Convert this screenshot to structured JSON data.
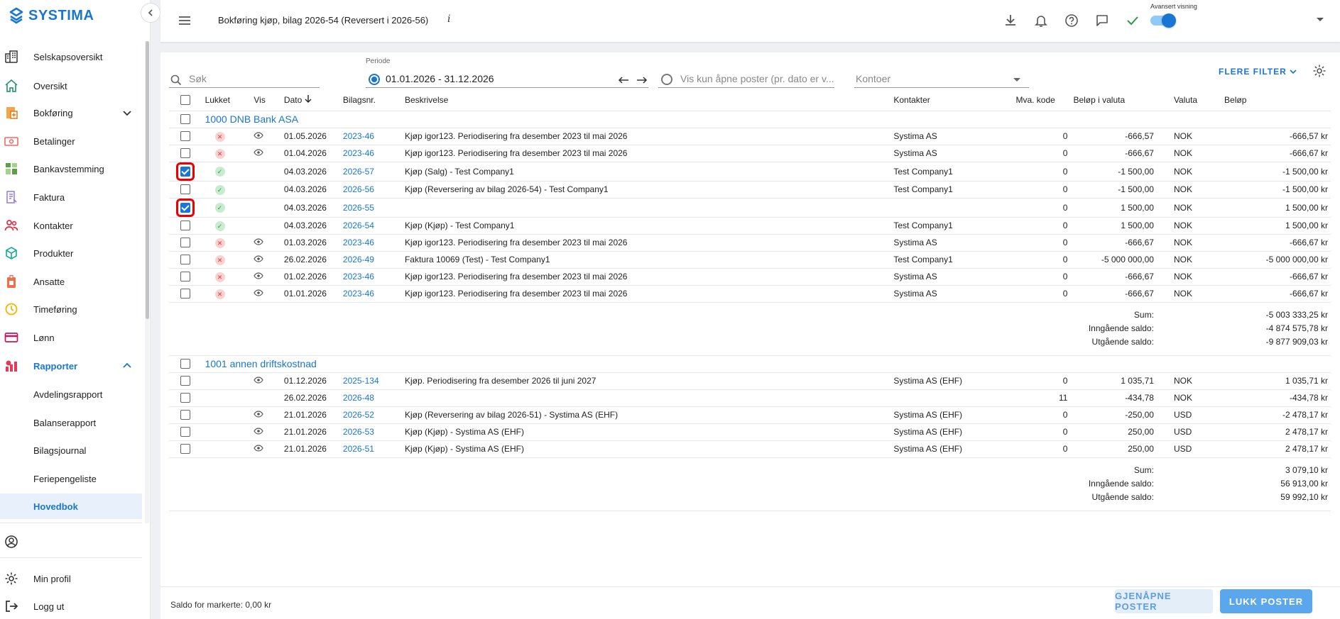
{
  "app": {
    "brand": "SYSTIMA"
  },
  "header": {
    "title": "Bokføring kjøp, bilag 2026-54 (Reversert i 2026-56)",
    "info": "i",
    "advanced_label": "Avansert visning"
  },
  "sidebar": {
    "items": [
      {
        "label": "Selskapsoversikt",
        "icon": "office-building-icon"
      },
      {
        "label": "Oversikt",
        "icon": "home-icon"
      },
      {
        "label": "Bokføring",
        "icon": "ledger-icon"
      },
      {
        "label": "Betalinger",
        "icon": "cash-icon"
      },
      {
        "label": "Bankavstemming",
        "icon": "bank-icon"
      },
      {
        "label": "Faktura",
        "icon": "invoice-icon"
      },
      {
        "label": "Kontakter",
        "icon": "people-icon"
      },
      {
        "label": "Produkter",
        "icon": "cube-icon"
      },
      {
        "label": "Ansatte",
        "icon": "badge-icon"
      },
      {
        "label": "Timeføring",
        "icon": "clock-icon"
      },
      {
        "label": "Lønn",
        "icon": "card-icon"
      },
      {
        "label": "Rapporter",
        "icon": "report-icon"
      }
    ],
    "sub_items": [
      "Avdelingsrapport",
      "Balanserapport",
      "Bilagsjournal",
      "Feriepengeliste",
      "Hovedbok"
    ],
    "bottom": [
      {
        "label": "Min profil",
        "icon": "gear-icon"
      },
      {
        "label": "Logg ut",
        "icon": "logout-icon"
      }
    ]
  },
  "filters": {
    "search_placeholder": "Søk",
    "period_label": "Periode",
    "period_value": "01.01.2026 - 31.12.2026",
    "open_posts_placeholder": "Vis kun åpne poster (pr. dato er v...",
    "accounts_placeholder": "Kontoer",
    "more_filters": "FLERE FILTER"
  },
  "table": {
    "headers": [
      "Lukket",
      "Vis",
      "Dato",
      "Bilagsnr.",
      "Beskrivelse",
      "Kontakter",
      "Mva. kode",
      "Beløp i valuta",
      "Valuta",
      "Beløp"
    ],
    "groups": [
      {
        "title": "1000 DNB Bank ASA",
        "rows": [
          {
            "checked": false,
            "hl": false,
            "status": "closed",
            "eye": true,
            "date": "01.05.2026",
            "bilag": "2023-46",
            "desc": "Kjøp igor123. Periodisering fra desember 2023 til mai 2026",
            "contact": "Systima AS",
            "mva": "0",
            "valuta_amount": "-666,57",
            "currency": "NOK",
            "amount": "-666,57 kr"
          },
          {
            "checked": false,
            "hl": false,
            "status": "closed",
            "eye": true,
            "date": "01.04.2026",
            "bilag": "2023-46",
            "desc": "Kjøp igor123. Periodisering fra desember 2023 til mai 2026",
            "contact": "Systima AS",
            "mva": "0",
            "valuta_amount": "-666,67",
            "currency": "NOK",
            "amount": "-666,67 kr"
          },
          {
            "checked": true,
            "hl": true,
            "status": "open",
            "eye": false,
            "date": "04.03.2026",
            "bilag": "2026-57",
            "desc": "Kjøp (Salg) - Test Company1",
            "contact": "Test Company1",
            "mva": "0",
            "valuta_amount": "-1 500,00",
            "currency": "NOK",
            "amount": "-1 500,00 kr"
          },
          {
            "checked": false,
            "hl": false,
            "status": "open",
            "eye": false,
            "date": "04.03.2026",
            "bilag": "2026-56",
            "desc": "Kjøp (Reversering av bilag 2026-54) - Test Company1",
            "contact": "Test Company1",
            "mva": "0",
            "valuta_amount": "-1 500,00",
            "currency": "NOK",
            "amount": "-1 500,00 kr"
          },
          {
            "checked": true,
            "hl": true,
            "status": "open",
            "eye": false,
            "date": "04.03.2026",
            "bilag": "2026-55",
            "desc": "",
            "contact": "",
            "mva": "0",
            "valuta_amount": "1 500,00",
            "currency": "NOK",
            "amount": "1 500,00 kr"
          },
          {
            "checked": false,
            "hl": false,
            "status": "open",
            "eye": false,
            "date": "04.03.2026",
            "bilag": "2026-54",
            "desc": "Kjøp (Kjøp) - Test Company1",
            "contact": "Test Company1",
            "mva": "0",
            "valuta_amount": "1 500,00",
            "currency": "NOK",
            "amount": "1 500,00 kr"
          },
          {
            "checked": false,
            "hl": false,
            "status": "closed",
            "eye": true,
            "date": "01.03.2026",
            "bilag": "2023-46",
            "desc": "Kjøp igor123. Periodisering fra desember 2023 til mai 2026",
            "contact": "Systima AS",
            "mva": "0",
            "valuta_amount": "-666,67",
            "currency": "NOK",
            "amount": "-666,67 kr"
          },
          {
            "checked": false,
            "hl": false,
            "status": "closed",
            "eye": true,
            "date": "26.02.2026",
            "bilag": "2026-49",
            "desc": "Faktura 10069 (Test) - Test Company1",
            "contact": "Test Company1",
            "mva": "0",
            "valuta_amount": "-5 000 000,00",
            "currency": "NOK",
            "amount": "-5 000 000,00 kr"
          },
          {
            "checked": false,
            "hl": false,
            "status": "closed",
            "eye": true,
            "date": "01.02.2026",
            "bilag": "2023-46",
            "desc": "Kjøp igor123. Periodisering fra desember 2023 til mai 2026",
            "contact": "Systima AS",
            "mva": "0",
            "valuta_amount": "-666,67",
            "currency": "NOK",
            "amount": "-666,67 kr"
          },
          {
            "checked": false,
            "hl": false,
            "status": "closed",
            "eye": true,
            "date": "01.01.2026",
            "bilag": "2023-46",
            "desc": "Kjøp igor123. Periodisering fra desember 2023 til mai 2026",
            "contact": "Systima AS",
            "mva": "0",
            "valuta_amount": "-666,67",
            "currency": "NOK",
            "amount": "-666,67 kr"
          }
        ],
        "summary": [
          {
            "label": "Sum:",
            "value": "-5 003 333,25 kr"
          },
          {
            "label": "Inngående saldo:",
            "value": "-4 874 575,78 kr"
          },
          {
            "label": "Utgående saldo:",
            "value": "-9 877 909,03 kr"
          }
        ]
      },
      {
        "title": "1001 annen driftskostnad",
        "rows": [
          {
            "checked": false,
            "hl": false,
            "status": "",
            "eye": true,
            "date": "01.12.2026",
            "bilag": "2025-134",
            "desc": "Kjøp. Periodisering fra desember 2026 til juni 2027",
            "contact": "Systima AS (EHF)",
            "mva": "0",
            "valuta_amount": "1 035,71",
            "currency": "NOK",
            "amount": "1 035,71 kr"
          },
          {
            "checked": false,
            "hl": false,
            "status": "",
            "eye": false,
            "date": "26.02.2026",
            "bilag": "2026-48",
            "desc": "",
            "contact": "",
            "mva": "11",
            "valuta_amount": "-434,78",
            "currency": "NOK",
            "amount": "-434,78 kr"
          },
          {
            "checked": false,
            "hl": false,
            "status": "",
            "eye": true,
            "date": "21.01.2026",
            "bilag": "2026-52",
            "desc": "Kjøp (Reversering av bilag 2026-51) - Systima AS (EHF)",
            "contact": "Systima AS (EHF)",
            "mva": "0",
            "valuta_amount": "-250,00",
            "currency": "USD",
            "amount": "-2 478,17 kr"
          },
          {
            "checked": false,
            "hl": false,
            "status": "",
            "eye": true,
            "date": "21.01.2026",
            "bilag": "2026-53",
            "desc": "Kjøp (Kjøp) - Systima AS (EHF)",
            "contact": "Systima AS (EHF)",
            "mva": "0",
            "valuta_amount": "250,00",
            "currency": "USD",
            "amount": "2 478,17 kr"
          },
          {
            "checked": false,
            "hl": false,
            "status": "",
            "eye": true,
            "date": "21.01.2026",
            "bilag": "2026-51",
            "desc": "Kjøp (Kjøp) - Systima AS (EHF)",
            "contact": "Systima AS (EHF)",
            "mva": "0",
            "valuta_amount": "250,00",
            "currency": "USD",
            "amount": "2 478,17 kr"
          }
        ],
        "summary": [
          {
            "label": "Sum:",
            "value": "3 079,10 kr"
          },
          {
            "label": "Inngående saldo:",
            "value": "56 913,00 kr"
          },
          {
            "label": "Utgående saldo:",
            "value": "59 992,10 kr"
          }
        ]
      }
    ]
  },
  "footer": {
    "saldo": "Saldo for markerte: 0,00 kr",
    "reopen": "GJENÅPNE POSTER",
    "close": "LUKK POSTER"
  },
  "colors": {
    "accent": "#1976d2",
    "highlight": "#e00000",
    "closed": "#e53935",
    "open": "#2e9a45"
  }
}
